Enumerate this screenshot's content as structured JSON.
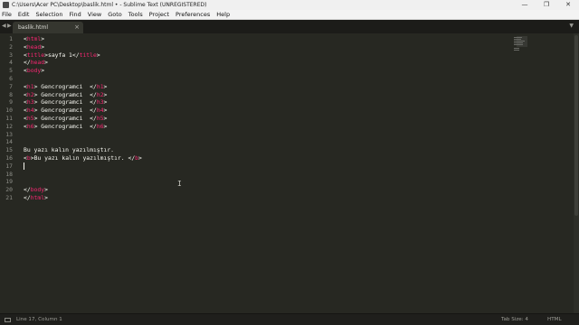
{
  "window": {
    "title": "C:\\Users\\Acer PC\\Desktop\\baslik.html • - Sublime Text (UNREGISTERED)",
    "controls": [
      "—",
      "❐",
      "✕"
    ]
  },
  "menu": [
    "File",
    "Edit",
    "Selection",
    "Find",
    "View",
    "Goto",
    "Tools",
    "Project",
    "Preferences",
    "Help"
  ],
  "tabs": {
    "nav_left": "◀",
    "nav_right": "▶",
    "active_label": "baslik.html",
    "close_glyph": "×",
    "dropdown_glyph": "▼"
  },
  "editor": {
    "line_numbers": [
      "1",
      "2",
      "3",
      "4",
      "5",
      "6",
      "7",
      "8",
      "9",
      "10",
      "11",
      "12",
      "13",
      "14",
      "15",
      "16",
      "17",
      "18",
      "19",
      "20",
      "21"
    ],
    "lines": [
      {
        "text": "<html>"
      },
      {
        "text": "<head>"
      },
      {
        "text": "<title>sayfa 1</title>"
      },
      {
        "text": "</head>"
      },
      {
        "text": "<body>"
      },
      {
        "text": ""
      },
      {
        "text": "<h1> Gencrogramci  </h1>"
      },
      {
        "text": "<h2> Gencrogramci  </h2>"
      },
      {
        "text": "<h3> Gencrogramci  </h3>"
      },
      {
        "text": "<h4> Gencrogramci  </h4>"
      },
      {
        "text": "<h5> Gencrogramci  </h5>"
      },
      {
        "text": "<h6> Gencrogramci  </h6>"
      },
      {
        "text": ""
      },
      {
        "text": ""
      },
      {
        "text": "Bu yazı kalın yazılmıştır."
      },
      {
        "text": "<b>Bu yazı kalın yazılmıştır. </b>"
      },
      {
        "text": ""
      },
      {
        "text": ""
      },
      {
        "text": ""
      },
      {
        "text": "</body>"
      },
      {
        "text": "</html>"
      }
    ],
    "current_line": 17
  },
  "status": {
    "position": "Line 17, Column 1",
    "tab_size": "Tab Size: 4",
    "syntax": "HTML"
  },
  "colors": {
    "background": "#272822",
    "tag": "#f92672",
    "text": "#f8f8f2",
    "line_number": "#8f908a"
  }
}
